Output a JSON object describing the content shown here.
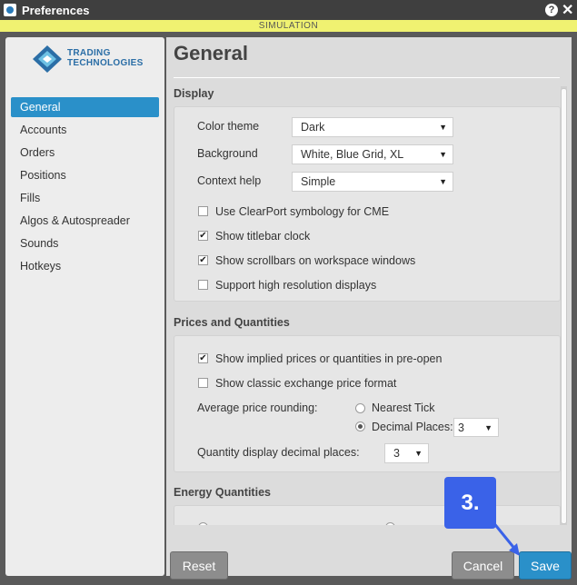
{
  "window": {
    "title": "Preferences",
    "help_icon": "?",
    "close_icon": "✕"
  },
  "simulation_banner": "SIMULATION",
  "logo": {
    "line1": "TRADING",
    "line2": "TECHNOLOGIES"
  },
  "sidebar": {
    "items": [
      {
        "label": "General",
        "active": true
      },
      {
        "label": "Accounts"
      },
      {
        "label": "Orders"
      },
      {
        "label": "Positions"
      },
      {
        "label": "Fills"
      },
      {
        "label": "Algos & Autospreader"
      },
      {
        "label": "Sounds"
      },
      {
        "label": "Hotkeys"
      }
    ]
  },
  "page_title": "General",
  "display": {
    "heading": "Display",
    "color_theme_label": "Color theme",
    "color_theme_value": "Dark",
    "background_label": "Background",
    "background_value": "White, Blue Grid, XL",
    "context_help_label": "Context help",
    "context_help_value": "Simple",
    "checkboxes": [
      {
        "label": "Use ClearPort symbology for CME",
        "checked": false
      },
      {
        "label": "Show titlebar clock",
        "checked": true
      },
      {
        "label": "Show scrollbars on workspace windows",
        "checked": true
      },
      {
        "label": "Support high resolution displays",
        "checked": false
      }
    ]
  },
  "prices": {
    "heading": "Prices and Quantities",
    "checkboxes": [
      {
        "label": "Show implied prices or quantities in pre-open",
        "checked": true
      },
      {
        "label": "Show classic exchange price format",
        "checked": false
      }
    ],
    "avg_rounding_label": "Average price rounding:",
    "nearest_tick_label": "Nearest Tick",
    "decimal_places_label": "Decimal Places:",
    "decimal_places_value": "3",
    "qty_decimal_label": "Quantity display decimal places:",
    "qty_decimal_value": "3"
  },
  "energy": {
    "heading": "Energy Quantities"
  },
  "footer": {
    "reset": "Reset",
    "cancel": "Cancel",
    "save": "Save"
  },
  "step_badge": "3.",
  "check_glyph": "✔",
  "arrow_glyph": "▼"
}
